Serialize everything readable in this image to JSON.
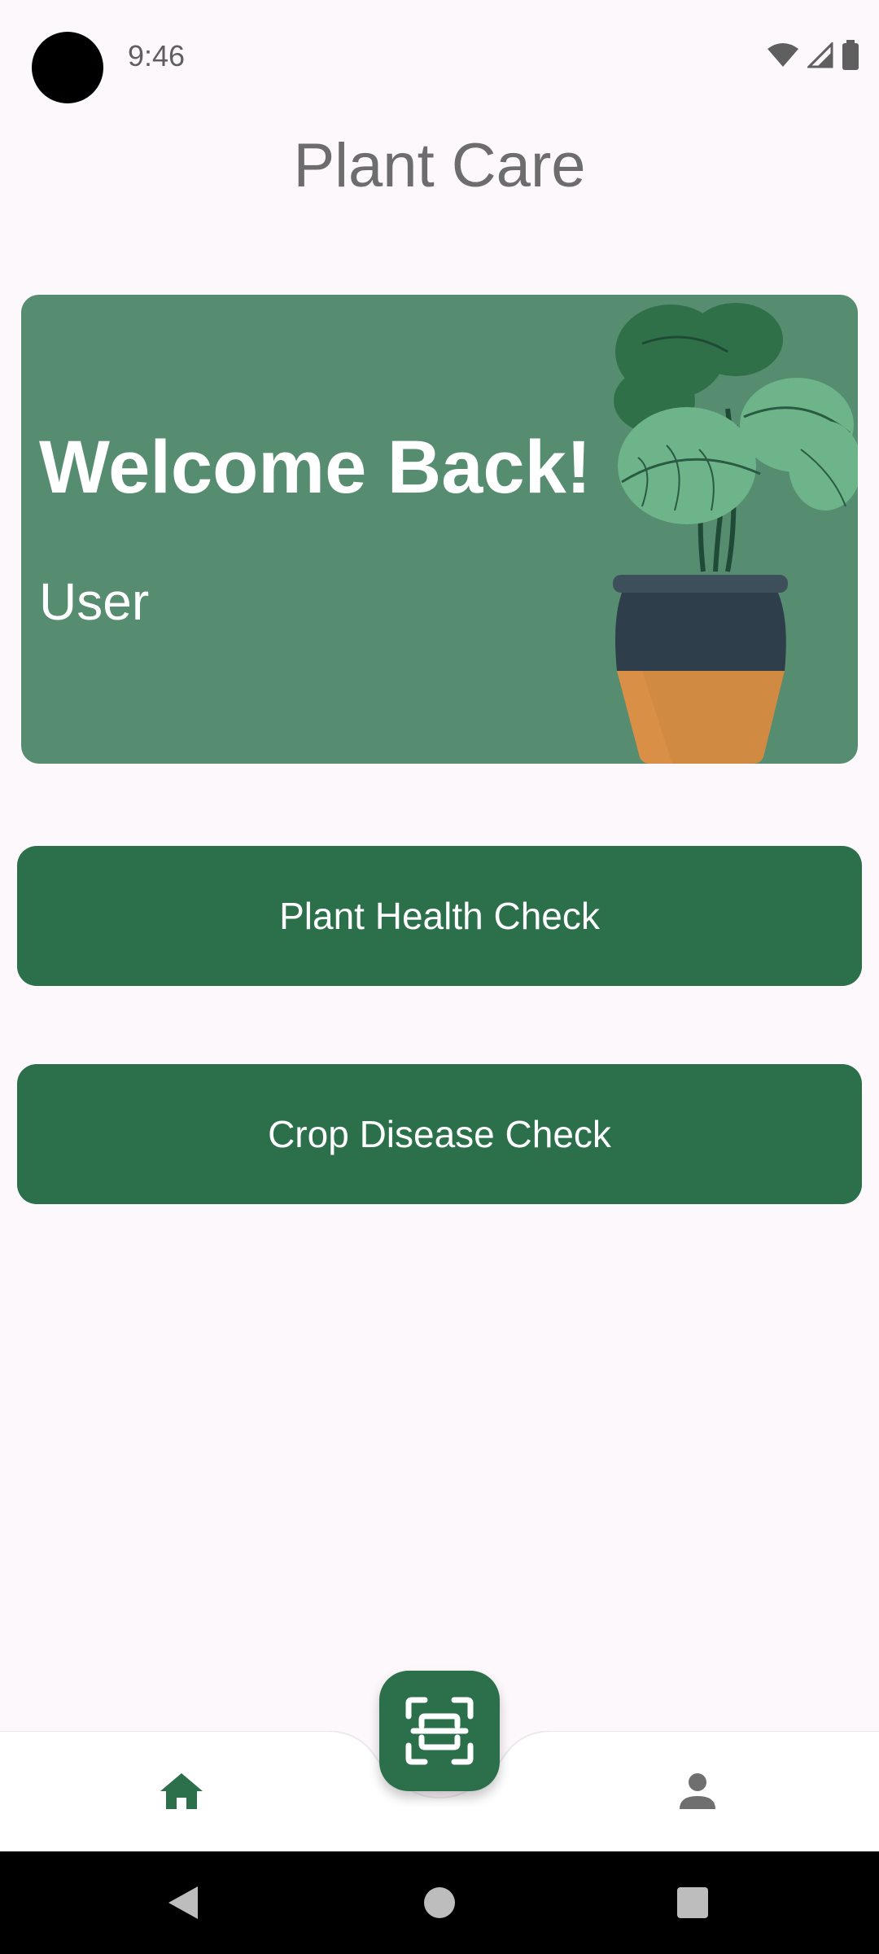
{
  "status_bar": {
    "time": "9:46"
  },
  "header": {
    "title": "Plant Care"
  },
  "welcome_card": {
    "heading": "Welcome Back!",
    "username": "User"
  },
  "actions": {
    "plant_health_label": "Plant Health Check",
    "crop_disease_label": "Crop Disease Check"
  },
  "bottom_nav": {
    "home_icon": "home-icon",
    "scan_icon": "scan-icon",
    "profile_icon": "person-icon"
  },
  "colors": {
    "primary": "#2b6f4b",
    "card": "#568c6f",
    "background": "#fdf8fc",
    "title_gray": "#6d6d6d"
  }
}
